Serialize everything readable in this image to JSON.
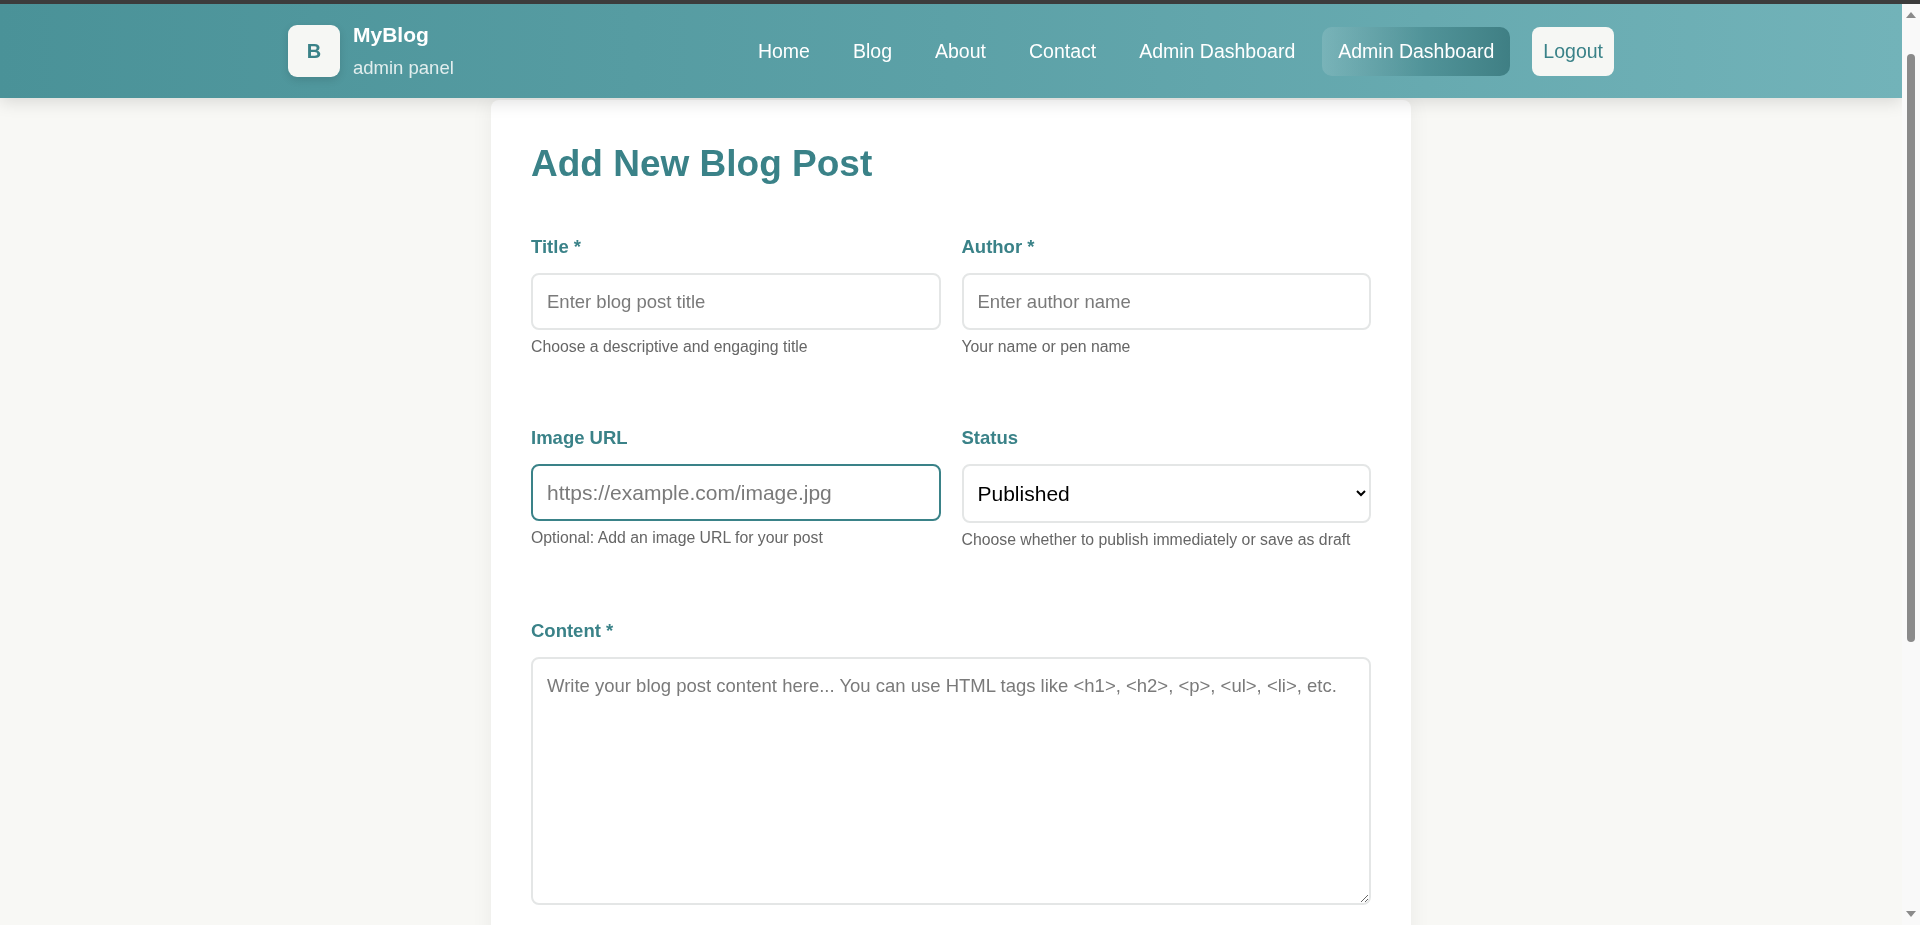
{
  "header": {
    "logo": {
      "letter": "B",
      "title": "MyBlog",
      "subtitle": "admin panel"
    },
    "nav": [
      {
        "label": "Home",
        "selected": false
      },
      {
        "label": "Blog",
        "selected": false
      },
      {
        "label": "About",
        "selected": false
      },
      {
        "label": "Contact",
        "selected": false
      },
      {
        "label": "Admin Dashboard",
        "selected": false
      },
      {
        "label": "Admin Dashboard",
        "selected": true
      }
    ],
    "logout": "Logout"
  },
  "form": {
    "heading": "Add New Blog Post",
    "fields": [
      {
        "kind": "text",
        "label": "Title *",
        "placeholder": "Enter blog post title",
        "help": "Choose a descriptive and engaging title",
        "focused": false
      },
      {
        "kind": "text",
        "label": "Author *",
        "placeholder": "Enter author name",
        "help": "Your name or pen name",
        "focused": false
      },
      {
        "kind": "url",
        "label": "Image URL",
        "placeholder": "https://example.com/image.jpg",
        "help": "Optional: Add an image URL for your post",
        "focused": true
      },
      {
        "kind": "select",
        "label": "Status",
        "value": "Published",
        "help": "Choose whether to publish immediately or save as draft",
        "focused": false
      },
      {
        "kind": "textarea",
        "label": "Content *",
        "placeholder": "Write your blog post content here... You can use HTML tags like <h1>, <h2>, <p>, <ul>, <li>, etc.",
        "focused": false
      }
    ]
  }
}
